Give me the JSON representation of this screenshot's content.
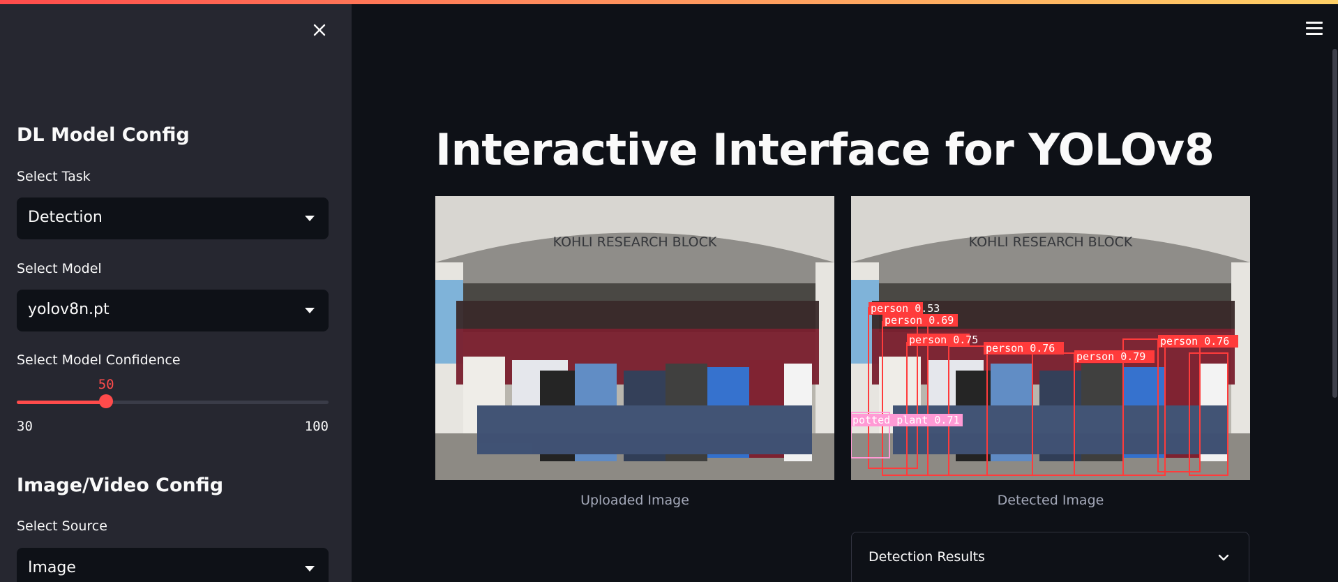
{
  "sidebar": {
    "dl_heading": "DL Model Config",
    "task": {
      "label": "Select Task",
      "value": "Detection"
    },
    "model": {
      "label": "Select Model",
      "value": "yolov8n.pt"
    },
    "confidence": {
      "label": "Select Model Confidence",
      "value": "50",
      "min": "30",
      "max": "100",
      "fraction": 0.2857
    },
    "io_heading": "Image/Video Config",
    "source": {
      "label": "Select Source",
      "value": "Image"
    }
  },
  "main": {
    "title": "Interactive Interface for YOLOv8",
    "uploaded_caption": "Uploaded Image",
    "detected_caption": "Detected Image",
    "building_sign": "KOHLI RESEARCH BLOCK",
    "detections": [
      {
        "label": "person 0.53"
      },
      {
        "label": "person 0.69"
      },
      {
        "label": "person 0.75"
      },
      {
        "label": "person 0.76"
      },
      {
        "label": "person 0.79"
      },
      {
        "label": "person 0.76"
      },
      {
        "label": "potted plant 0.71"
      }
    ],
    "expander_label": "Detection Results"
  },
  "colors": {
    "accent": "#ff4b4b",
    "sidebar_bg": "#262730",
    "main_bg": "#0e1117",
    "box_red": "#ff3b3b",
    "box_pink": "#ff9ad5"
  },
  "icons": {
    "close": "close-icon",
    "menu": "hamburger-menu-icon",
    "caret": "caret-down-icon",
    "chevron": "chevron-down-icon"
  }
}
